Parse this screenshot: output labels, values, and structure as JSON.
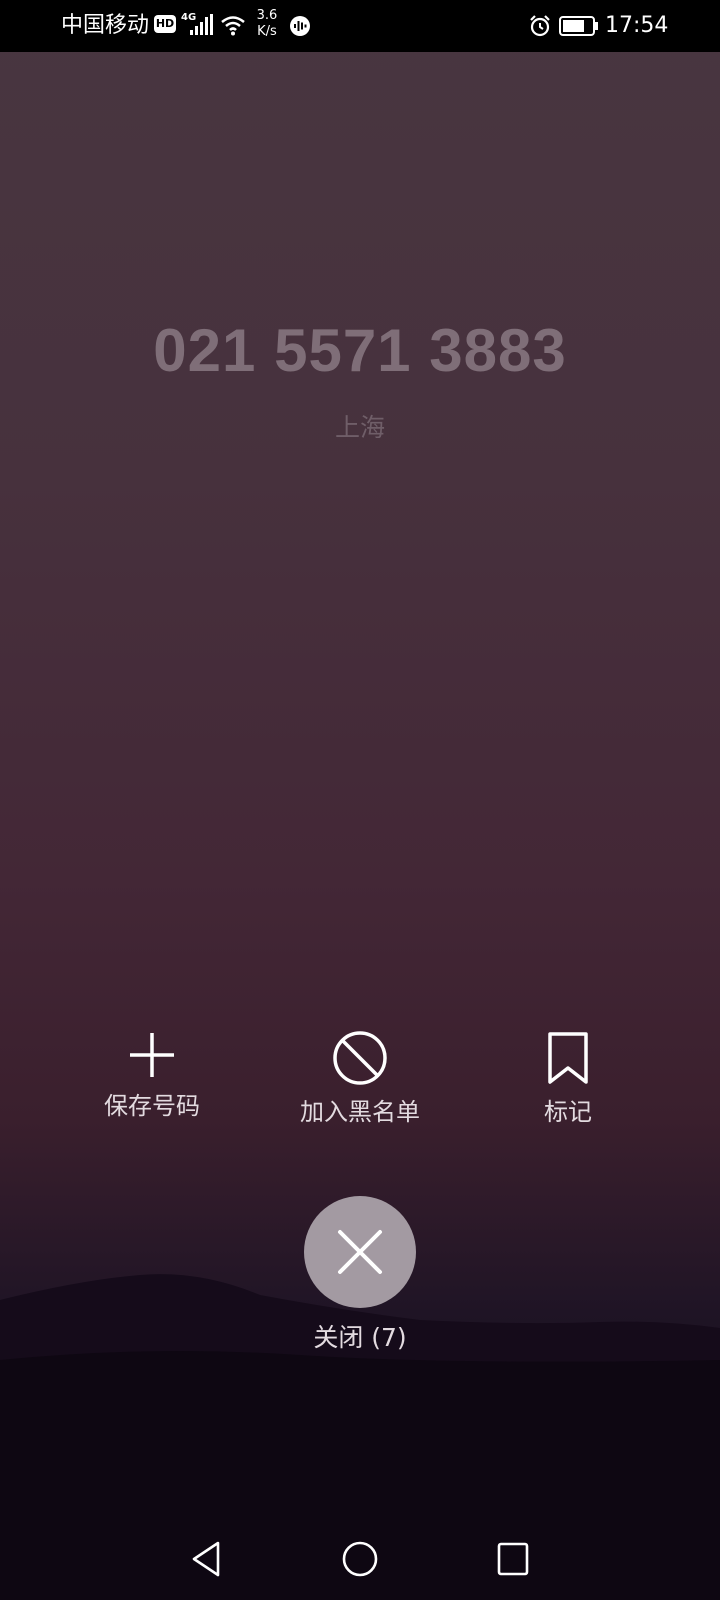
{
  "status_bar": {
    "carrier": "中国移动",
    "hd": "HD",
    "network": "4G",
    "speed_value": "3.6",
    "speed_unit": "K/s",
    "time": "17:54",
    "battery_level_percent": 75
  },
  "caller": {
    "number": "021 5571 3883",
    "location": "上海"
  },
  "actions": {
    "save_label": "保存号码",
    "block_label": "加入黑名单",
    "mark_label": "标记"
  },
  "close": {
    "label": "关闭 (7)"
  },
  "icons": {
    "save": "plus-icon",
    "block": "prohibited-icon",
    "mark": "bookmark-icon",
    "close": "close-icon",
    "back": "back-triangle-icon",
    "home": "home-circle-icon",
    "recents": "recents-square-icon"
  },
  "colors": {
    "close_button": "#a39aa2",
    "number_text": "#7f6e78"
  }
}
